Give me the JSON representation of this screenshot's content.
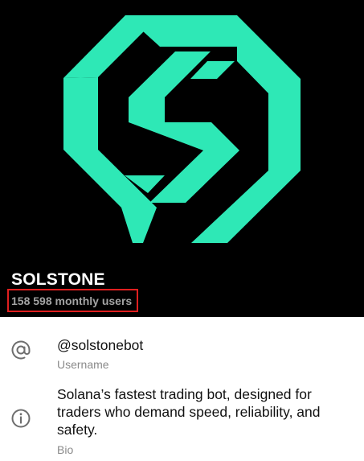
{
  "profile": {
    "name": "SOLSTONE",
    "monthly_users": "158 598 monthly users"
  },
  "details": {
    "username": {
      "value": "@solstonebot",
      "label": "Username"
    },
    "bio": {
      "value": "Solana’s fastest trading bot, designed for traders who demand speed, reliability, and safety.",
      "label": "Bio"
    }
  },
  "colors": {
    "logo_accent": "#2ee8b6",
    "hero_background": "#000000",
    "highlight_box": "#e01f1f"
  },
  "icons": {
    "username": "at-sign-icon",
    "bio": "info-icon"
  }
}
